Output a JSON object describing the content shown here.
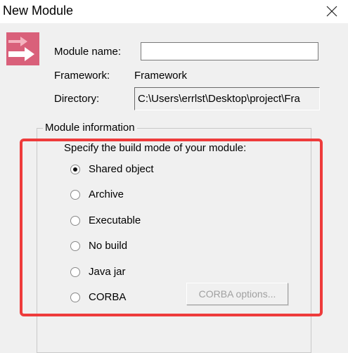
{
  "window": {
    "title": "New Module"
  },
  "form": {
    "module_name_label": "Module name:",
    "module_name_value": "",
    "framework_label": "Framework:",
    "framework_value": "Framework",
    "directory_label": "Directory:",
    "directory_value": "C:\\Users\\errlst\\Desktop\\project\\Fra"
  },
  "module_info": {
    "legend": "Module information",
    "prompt": "Specify the build mode of your module:",
    "options": [
      {
        "label": "Shared object",
        "selected": true
      },
      {
        "label": "Archive",
        "selected": false
      },
      {
        "label": "Executable",
        "selected": false
      },
      {
        "label": "No build",
        "selected": false
      },
      {
        "label": "Java jar",
        "selected": false
      },
      {
        "label": "CORBA",
        "selected": false
      }
    ],
    "corba_options_label": "CORBA options...",
    "corba_options_enabled": false
  },
  "colors": {
    "highlight": "#ee3b3b",
    "icon_background": "#d9607a"
  },
  "icons": {
    "module": "module-arrow-icon",
    "close": "close-icon"
  }
}
